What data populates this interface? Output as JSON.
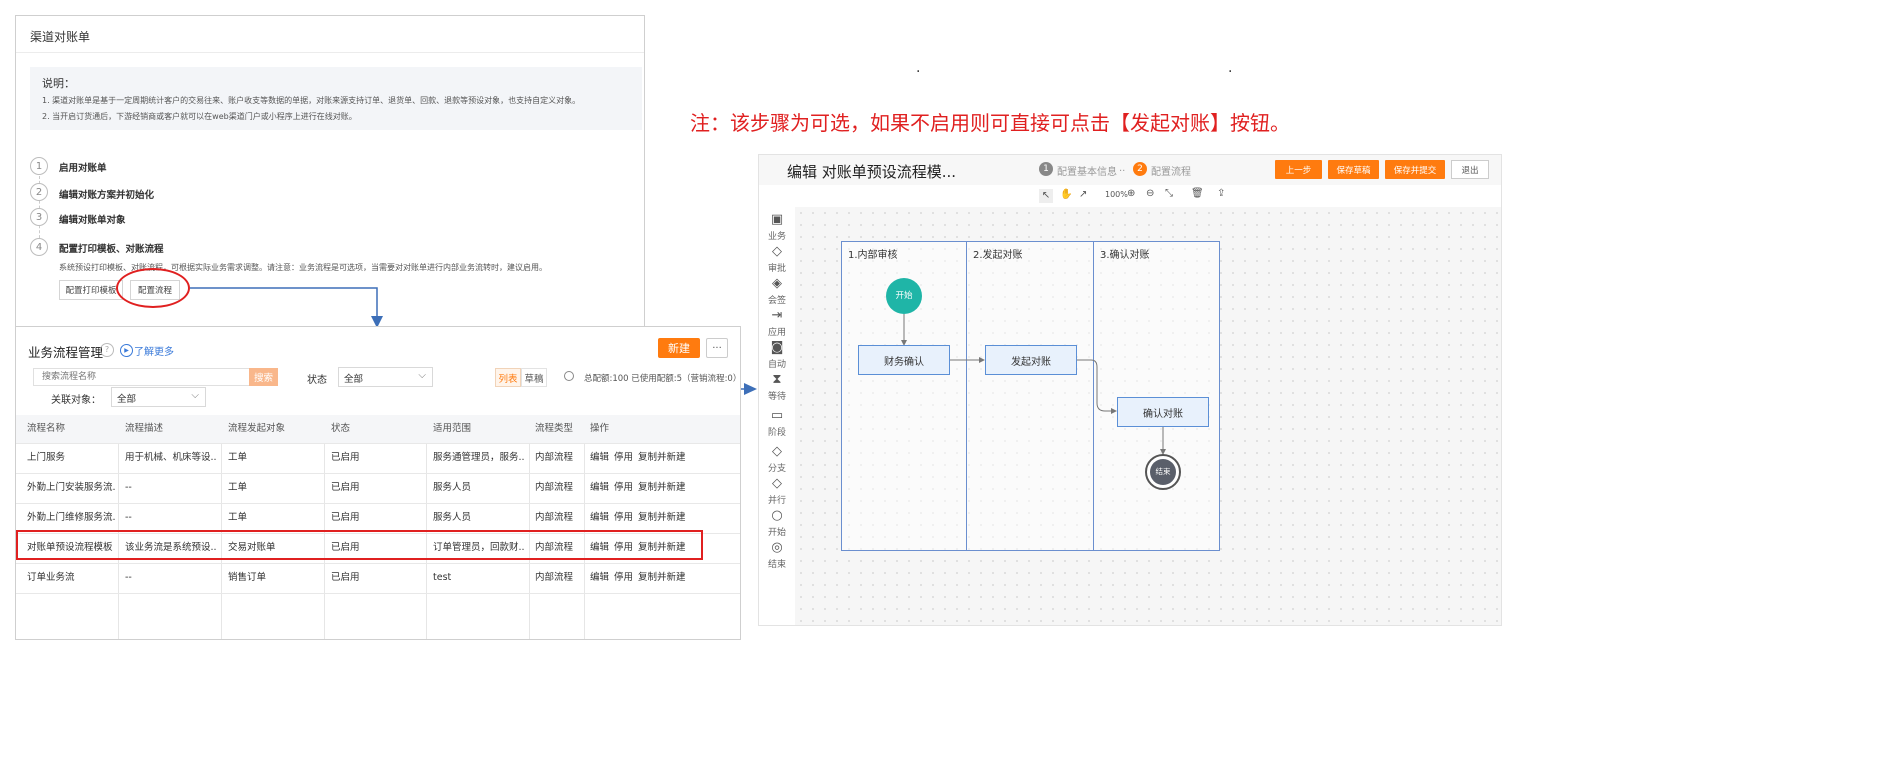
{
  "left_panel": {
    "title": "渠道对账单",
    "desc_heading": "说明：",
    "desc_lines": [
      "1. 渠道对账单是基于一定周期统计客户的交易往来、账户收支等数据的单据，对账来源支持订单、退货单、回款、退款等预设对象，也支持自定义对象。",
      "2. 当开启订货通后，下游经销商或客户就可以在web渠道门户或小程序上进行在线对账。"
    ],
    "steps": [
      {
        "num": "1",
        "label": "启用对账单"
      },
      {
        "num": "2",
        "label": "编辑对账方案并初始化"
      },
      {
        "num": "3",
        "label": "编辑对账单对象"
      },
      {
        "num": "4",
        "label": "配置打印模板、对账流程"
      }
    ],
    "step4_desc": "系统预设打印模板、对账流程，可根据实际业务需求调整。请注意：业务流程是可选项，当需要对对账单进行内部业务流转时，建议启用。",
    "btn_print_template": "配置打印模板",
    "btn_config_flow": "配置流程"
  },
  "flow_mgmt": {
    "title": "业务流程管理",
    "learn_more": "了解更多",
    "new_btn": "新建",
    "more_btn": "···",
    "search_placeholder": "搜索流程名称",
    "search_btn": "搜索",
    "status_label": "状态",
    "status_value": "全部",
    "tab_list": "列表",
    "tab_draft": "草稿",
    "quota_text": "总配额:100 已使用配额:5（营销流程:0）",
    "assoc_label": "关联对象：",
    "assoc_value": "全部",
    "columns": [
      "流程名称",
      "流程描述",
      "流程发起对象",
      "状态",
      "适用范围",
      "流程类型",
      "操作"
    ],
    "rows": [
      {
        "name": "上门服务",
        "desc": "用于机械、机床等设...",
        "obj": "工单",
        "status": "已启用",
        "scope": "服务通管理员，服务...",
        "type": "内部流程"
      },
      {
        "name": "外勤上门安装服务流...",
        "desc": "--",
        "obj": "工单",
        "status": "已启用",
        "scope": "服务人员",
        "type": "内部流程"
      },
      {
        "name": "外勤上门维修服务流...",
        "desc": "--",
        "obj": "工单",
        "status": "已启用",
        "scope": "服务人员",
        "type": "内部流程"
      },
      {
        "name": "对账单预设流程模板",
        "desc": "该业务流是系统预设...",
        "obj": "交易对账单",
        "status": "已启用",
        "scope": "订单管理员，回款财...",
        "type": "内部流程"
      },
      {
        "name": "订单业务流",
        "desc": "--",
        "obj": "销售订单",
        "status": "已启用",
        "scope": "test",
        "type": "内部流程"
      }
    ],
    "action_edit": "编辑",
    "action_disable": "停用",
    "action_copy": "复制并新建"
  },
  "note": "注：该步骤为可选，如果不启用则可直接可点击【发起对账】按钮。",
  "dots": [
    ".",
    "."
  ],
  "editor": {
    "title": "编辑 对账单预设流程模...",
    "step1_num": "1",
    "step1_label": "配置基本信息",
    "step_sep": "..",
    "step2_num": "2",
    "step2_label": "配置流程",
    "btn_prev": "上一步",
    "btn_save_draft": "保存草稿",
    "btn_save_submit": "保存并提交",
    "btn_exit": "退出",
    "zoom": "100%",
    "palette": [
      {
        "icon": "user-icon",
        "glyph": "▣",
        "label": "业务"
      },
      {
        "icon": "approve-icon",
        "glyph": "◇",
        "label": "审批"
      },
      {
        "icon": "countersign-icon",
        "glyph": "◈",
        "label": "会签"
      },
      {
        "icon": "app-icon",
        "glyph": "⇥",
        "label": "应用"
      },
      {
        "icon": "auto-icon",
        "glyph": "◙",
        "label": "自动"
      },
      {
        "icon": "wait-icon",
        "glyph": "⧗",
        "label": "等待"
      },
      {
        "icon": "stage-icon",
        "glyph": "▭",
        "label": "阶段"
      },
      {
        "icon": "branch-icon",
        "glyph": "◇",
        "label": "分支"
      },
      {
        "icon": "parallel-icon",
        "glyph": "◇",
        "label": "并行"
      },
      {
        "icon": "start-icon",
        "glyph": "○",
        "label": "开始"
      },
      {
        "icon": "end-icon",
        "glyph": "◎",
        "label": "结束"
      }
    ],
    "lanes": [
      "1.内部审核",
      "2.发起对账",
      "3.确认对账"
    ],
    "node_start": "开始",
    "node_finance": "财务确认",
    "node_initiate": "发起对账",
    "node_confirm": "确认对账",
    "node_end": "结束"
  },
  "colors": {
    "accent": "#ff7b0f",
    "highlight": "#e02020",
    "link": "#3a7ad9",
    "start_node": "#1fb5a7"
  }
}
